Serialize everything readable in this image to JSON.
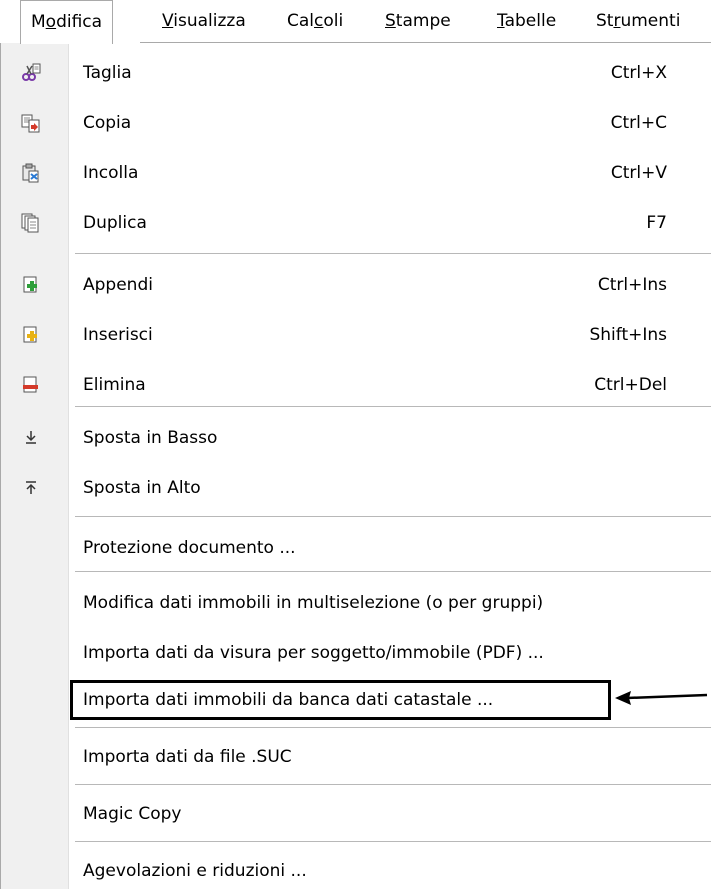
{
  "menubar": {
    "items": [
      {
        "pre": "M",
        "ul": "o",
        "post": "difica",
        "active": true
      },
      {
        "pre": "",
        "ul": "V",
        "post": "isualizza",
        "active": false
      },
      {
        "pre": "Cal",
        "ul": "c",
        "post": "oli",
        "active": false
      },
      {
        "pre": "",
        "ul": "S",
        "post": "tampe",
        "active": false
      },
      {
        "pre": "",
        "ul": "T",
        "post": "abelle",
        "active": false
      },
      {
        "pre": "St",
        "ul": "r",
        "post": "umenti",
        "active": false
      }
    ]
  },
  "menu": {
    "items": [
      {
        "label": "Taglia",
        "shortcut": "Ctrl+X",
        "icon": "cut-icon"
      },
      {
        "label": "Copia",
        "shortcut": "Ctrl+C",
        "icon": "copy-icon"
      },
      {
        "label": "Incolla",
        "shortcut": "Ctrl+V",
        "icon": "paste-icon"
      },
      {
        "label": "Duplica",
        "shortcut": "F7",
        "icon": "duplicate-icon"
      },
      {
        "label": "Appendi",
        "shortcut": "Ctrl+Ins",
        "icon": "append-icon"
      },
      {
        "label": "Inserisci",
        "shortcut": "Shift+Ins",
        "icon": "insert-icon"
      },
      {
        "label": "Elimina",
        "shortcut": "Ctrl+Del",
        "icon": "delete-icon"
      },
      {
        "label": "Sposta in Basso",
        "shortcut": "",
        "icon": "move-down-icon"
      },
      {
        "label": "Sposta in Alto",
        "shortcut": "",
        "icon": "move-up-icon"
      },
      {
        "label": "Protezione documento ...",
        "shortcut": "",
        "icon": ""
      },
      {
        "label": "Modifica dati immobili in multiselezione (o per gruppi)",
        "shortcut": "",
        "icon": ""
      },
      {
        "label": "Importa dati da visura per soggetto/immobile (PDF) ...",
        "shortcut": "",
        "icon": ""
      },
      {
        "label": "Importa dati immobili da banca dati catastale ...",
        "shortcut": "",
        "icon": ""
      },
      {
        "label": "Importa dati da file .SUC",
        "shortcut": "",
        "icon": ""
      },
      {
        "label": "Magic Copy",
        "shortcut": "",
        "icon": ""
      },
      {
        "label": "Agevolazioni e riduzioni ...",
        "shortcut": "",
        "icon": ""
      }
    ]
  },
  "colors": {
    "gutter": "#f0f0f0",
    "separator": "#b8b8b8",
    "annotation": "#000000"
  }
}
